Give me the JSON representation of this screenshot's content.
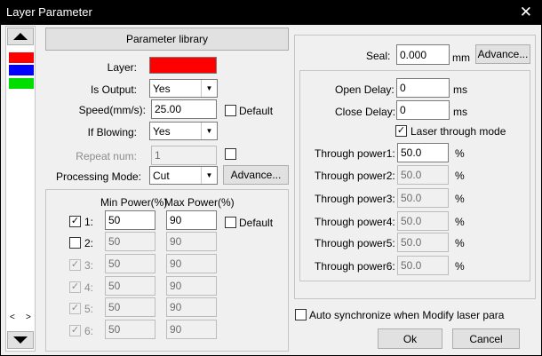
{
  "window": {
    "title": "Layer Parameter",
    "close_glyph": "✕"
  },
  "layers": {
    "colors": [
      "#ff0000",
      "#0000ff",
      "#00dd00"
    ],
    "scroll_left": "<",
    "scroll_right": ">"
  },
  "left": {
    "parameter_library": "Parameter library",
    "layer_label": "Layer:",
    "layer_color": "#ff0000",
    "is_output_label": "Is Output:",
    "is_output_value": "Yes",
    "speed_label": "Speed(mm/s):",
    "speed_value": "25.00",
    "default_label": "Default",
    "if_blowing_label": "If Blowing:",
    "if_blowing_value": "Yes",
    "repeat_label": "Repeat num:",
    "repeat_value": "1",
    "processing_mode_label": "Processing Mode:",
    "processing_mode_value": "Cut",
    "advance_label": "Advance...",
    "min_power_header": "Min Power(%)",
    "max_power_header": "Max Power(%)",
    "power_default_label": "Default",
    "power_rows": [
      {
        "label": "1:",
        "checked": "✓",
        "min": "50",
        "max": "90"
      },
      {
        "label": "2:",
        "checked": "",
        "min": "50",
        "max": "90"
      },
      {
        "label": "3:",
        "checked": "✓",
        "min": "50",
        "max": "90"
      },
      {
        "label": "4:",
        "checked": "✓",
        "min": "50",
        "max": "90"
      },
      {
        "label": "5:",
        "checked": "✓",
        "min": "50",
        "max": "90"
      },
      {
        "label": "6:",
        "checked": "✓",
        "min": "50",
        "max": "90"
      }
    ]
  },
  "right": {
    "seal_label": "Seal:",
    "seal_value": "0.000",
    "seal_unit": "mm",
    "advance_label": "Advance...",
    "open_delay_label": "Open Delay:",
    "open_delay_value": "0",
    "close_delay_label": "Close Delay:",
    "close_delay_value": "0",
    "delay_unit": "ms",
    "laser_through_label": "Laser through mode",
    "through_rows": [
      {
        "label": "Through power1:",
        "value": "50.0",
        "unit": "%"
      },
      {
        "label": "Through power2:",
        "value": "50.0",
        "unit": "%"
      },
      {
        "label": "Through power3:",
        "value": "50.0",
        "unit": "%"
      },
      {
        "label": "Through power4:",
        "value": "50.0",
        "unit": "%"
      },
      {
        "label": "Through power5:",
        "value": "50.0",
        "unit": "%"
      },
      {
        "label": "Through power6:",
        "value": "50.0",
        "unit": "%"
      }
    ],
    "auto_sync_label": "Auto synchronize when Modify laser para",
    "ok_label": "Ok",
    "cancel_label": "Cancel"
  }
}
